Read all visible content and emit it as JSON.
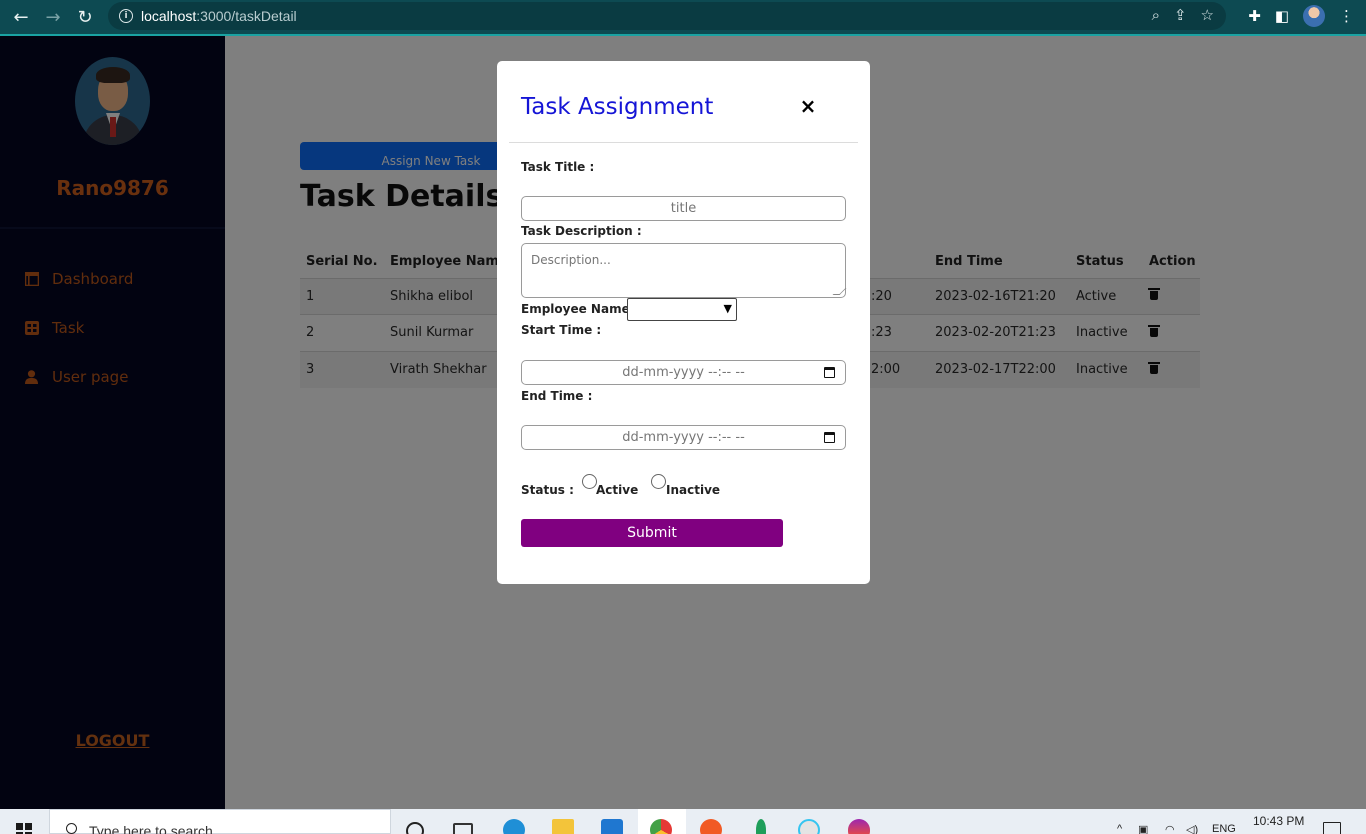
{
  "browser": {
    "url_host": "localhost",
    "url_path": ":3000/taskDetail"
  },
  "sidebar": {
    "username": "Rano9876",
    "items": [
      {
        "label": "Dashboard",
        "icon": "dashboard-icon"
      },
      {
        "label": "Task",
        "icon": "task-icon"
      },
      {
        "label": "User page",
        "icon": "user-icon"
      }
    ],
    "logout_label": "LOGOUT"
  },
  "main": {
    "assign_button_label": "Assign New Task",
    "page_title": "Task Details",
    "table": {
      "headers": [
        "Serial No.",
        "Employee Name",
        "End Time",
        "Status",
        "Action"
      ],
      "rows": [
        {
          "serial": "1",
          "name": "Shikha elibol",
          "start_partial": ":20",
          "end": "2023-02-16T21:20",
          "status": "Active"
        },
        {
          "serial": "2",
          "name": "Sunil Kurmar",
          "start_partial": ":23",
          "end": "2023-02-20T21:23",
          "status": "Inactive"
        },
        {
          "serial": "3",
          "name": "Virath Shekhar",
          "start_partial": "2:00",
          "end": "2023-02-17T22:00",
          "status": "Inactive"
        }
      ]
    }
  },
  "modal": {
    "title": "Task Assignment",
    "close_glyph": "×",
    "task_title_label": "Task Title :",
    "task_title_placeholder": "title",
    "task_description_label": "Task Description :",
    "task_description_placeholder": "Description...",
    "employee_name_label": "Employee Name :",
    "start_time_label": "Start Time :",
    "start_time_placeholder": "dd-mm-yyyy --:-- --",
    "end_time_label": "End Time :",
    "end_time_placeholder": "dd-mm-yyyy --:-- --",
    "status_label": "Status :",
    "status_options": [
      "Active",
      "Inactive"
    ],
    "submit_label": "Submit"
  },
  "taskbar": {
    "search_placeholder": "Type here to search",
    "language": "ENG",
    "time": "10:43 PM"
  },
  "colors": {
    "sidebar_bg": "#040622",
    "sidebar_accent": "#c35a1b",
    "modal_title": "#1515d6",
    "submit_bg": "#800080",
    "primary_button": "#0d6efd"
  }
}
